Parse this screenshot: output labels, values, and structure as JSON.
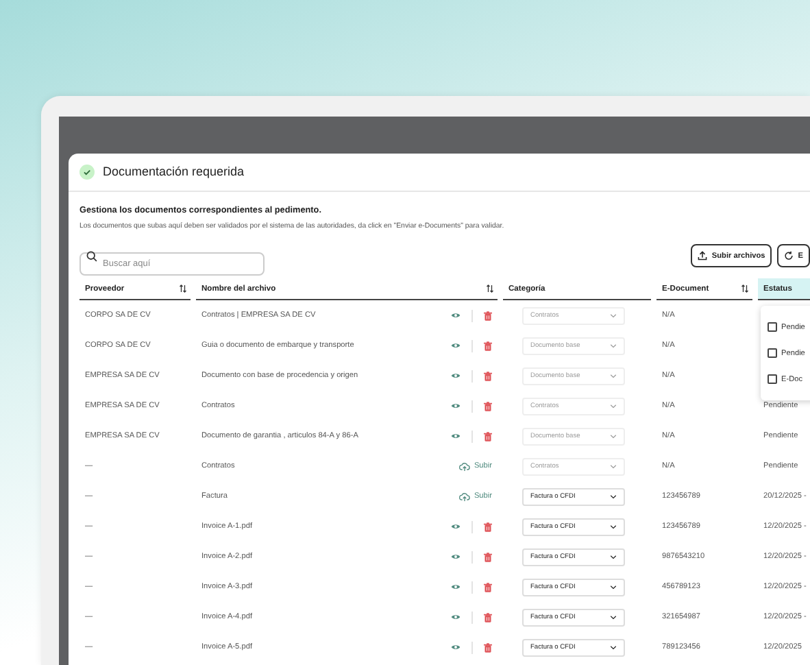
{
  "modal": {
    "title": "Documentación requerida",
    "subtitle": "Gestiona los documentos correspondientes al pedimento.",
    "description": "Los documentos que subas aquí deben ser validados por el sistema de las autoridades, da click en \"Enviar e-Documents\" para validar.",
    "search": {
      "placeholder": "Buscar aquí"
    },
    "buttons": [
      {
        "label": "Subir archivos",
        "kind": "upload"
      },
      {
        "label": "E",
        "kind": "refresh"
      }
    ]
  },
  "table": {
    "columns": [
      {
        "label": "Proveedor",
        "sortable": true,
        "filter_open": false
      },
      {
        "label": "Nombre del archivo",
        "sortable": true,
        "filter_open": false
      },
      {
        "label": "Categoría",
        "sortable": false,
        "filter_open": false
      },
      {
        "label": "E-Document",
        "sortable": true,
        "filter_open": false
      },
      {
        "label": "Estatus",
        "sortable": false,
        "filter_open": true
      }
    ],
    "status_filter": [
      {
        "label": "Pendie",
        "checked": false
      },
      {
        "label": "Pendie",
        "checked": false
      },
      {
        "label": "E-Doc",
        "checked": false
      }
    ],
    "rows": [
      {
        "provider": "CORPO SA DE CV",
        "file": "Contratos | EMPRESA SA DE CV",
        "kind": "view",
        "category": "Contratos",
        "category_disabled": true,
        "edocument": "N/A",
        "status": ""
      },
      {
        "provider": "CORPO SA DE CV",
        "file": "Guia o documento de embarque y transporte",
        "kind": "view",
        "category": "Documento base",
        "category_disabled": true,
        "edocument": "N/A",
        "status": ""
      },
      {
        "provider": "EMPRESA SA DE CV",
        "file": "Documento con base de procedencia y origen",
        "kind": "view",
        "category": "Documento base",
        "category_disabled": true,
        "edocument": "N/A",
        "status": ""
      },
      {
        "provider": "EMPRESA SA DE CV",
        "file": "Contratos",
        "kind": "view",
        "category": "Contratos",
        "category_disabled": true,
        "edocument": "N/A",
        "status": "Pendiente"
      },
      {
        "provider": "EMPRESA SA DE CV",
        "file": "Documento de garantia , articulos 84-A y 86-A",
        "kind": "view",
        "category": "Documento base",
        "category_disabled": true,
        "edocument": "N/A",
        "status": "Pendiente"
      },
      {
        "provider": "—",
        "file": "Contratos",
        "kind": "upload",
        "action_label": "Subir",
        "category": "Contratos",
        "category_disabled": true,
        "edocument": "N/A",
        "status": "Pendiente"
      },
      {
        "provider": "—",
        "file": "Factura",
        "kind": "upload",
        "action_label": "Subir",
        "category": "Factura o CFDI",
        "category_disabled": false,
        "edocument": "123456789",
        "status": "20/12/2025 -"
      },
      {
        "provider": "—",
        "file": "Invoice A-1.pdf",
        "kind": "view",
        "category": "Factura o CFDI",
        "category_disabled": false,
        "edocument": "123456789",
        "status": "12/20/2025 -"
      },
      {
        "provider": "—",
        "file": "Invoice A-2.pdf",
        "kind": "view",
        "category": "Factura o CFDI",
        "category_disabled": false,
        "edocument": "9876543210",
        "status": "12/20/2025 -"
      },
      {
        "provider": "—",
        "file": "Invoice A-3.pdf",
        "kind": "view",
        "category": "Factura o CFDI",
        "category_disabled": false,
        "edocument": "456789123",
        "status": "12/20/2025 -"
      },
      {
        "provider": "—",
        "file": "Invoice A-4.pdf",
        "kind": "view",
        "category": "Factura o CFDI",
        "category_disabled": false,
        "edocument": "321654987",
        "status": "12/20/2025 -"
      },
      {
        "provider": "—",
        "file": "Invoice A-5.pdf",
        "kind": "view",
        "category": "Factura o CFDI",
        "category_disabled": false,
        "edocument": "789123456",
        "status": "12/20/2025"
      }
    ]
  }
}
